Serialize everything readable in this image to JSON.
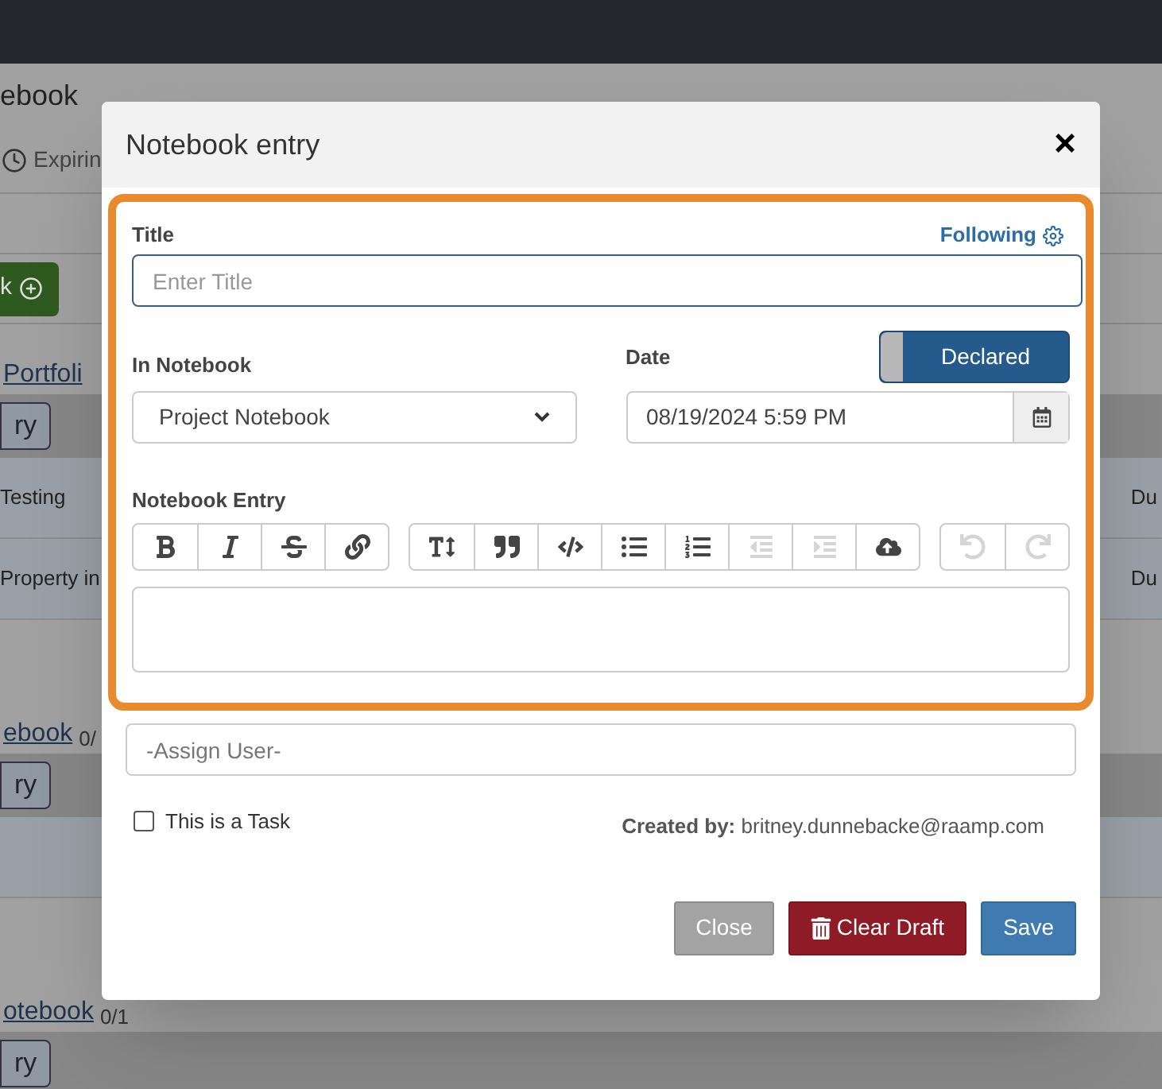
{
  "background": {
    "heading": "ebook",
    "tab": "Expirin",
    "add_button": "k",
    "sections": [
      {
        "link": "Portfoli",
        "button": "ry",
        "rows": [
          {
            "name": "Testing",
            "status": "Du"
          },
          {
            "name": "Property in",
            "status": "Du"
          }
        ]
      },
      {
        "link": "ebook",
        "count": "0/",
        "button": "ry",
        "rows": [
          {
            "name": "",
            "status": ""
          }
        ]
      },
      {
        "link": "otebook",
        "count": "0/1",
        "button": "ry"
      }
    ]
  },
  "dialog": {
    "title": "Notebook entry",
    "close": "×",
    "title_field": {
      "label": "Title",
      "placeholder": "Enter Title",
      "following": "Following"
    },
    "notebook_field": {
      "label": "In Notebook",
      "value": "Project Notebook"
    },
    "date_field": {
      "label": "Date",
      "value": "08/19/2024 5:59 PM",
      "toggle": {
        "label": "Declared",
        "on": true
      }
    },
    "entry_field": {
      "label": "Notebook Entry",
      "toolbar": [
        [
          {
            "kind": "bold",
            "disabled": false
          },
          {
            "kind": "italic",
            "disabled": false
          },
          {
            "kind": "strike",
            "disabled": false
          },
          {
            "kind": "link",
            "disabled": false
          }
        ],
        [
          {
            "kind": "heading",
            "disabled": false
          },
          {
            "kind": "quote",
            "disabled": false
          },
          {
            "kind": "code",
            "disabled": false
          },
          {
            "kind": "bullets",
            "disabled": false
          },
          {
            "kind": "numbers",
            "disabled": false
          },
          {
            "kind": "outdent",
            "disabled": true
          },
          {
            "kind": "indent",
            "disabled": true
          },
          {
            "kind": "upload",
            "disabled": false
          }
        ],
        [
          {
            "kind": "undo",
            "disabled": true
          },
          {
            "kind": "redo",
            "disabled": true
          }
        ]
      ]
    },
    "assign_field": {
      "placeholder": "-Assign User-"
    },
    "task": {
      "label": "This is a Task",
      "checked": false
    },
    "created_by": {
      "label": "Created by:",
      "value": "britney.dunnebacke@raamp.com"
    },
    "buttons": [
      {
        "kind": "close",
        "label": "Close"
      },
      {
        "kind": "clear",
        "label": "Clear Draft"
      },
      {
        "kind": "save",
        "label": "Save"
      }
    ]
  }
}
